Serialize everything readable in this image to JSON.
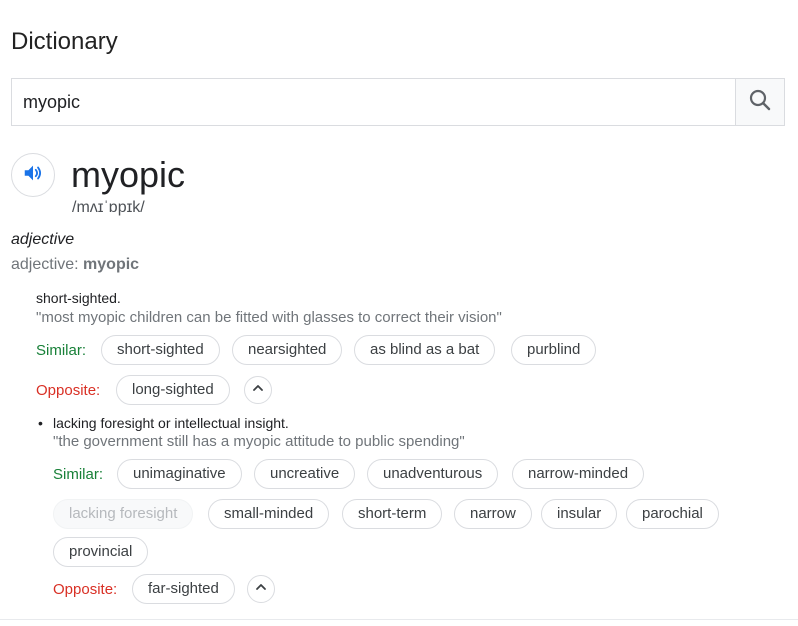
{
  "panel": {
    "title": "Dictionary"
  },
  "search": {
    "value": "myopic"
  },
  "entry": {
    "word": "myopic",
    "phonetic": "/mʌɪˈɒpɪk/",
    "part_of_speech": "adjective",
    "pos_prefix": "adjective: ",
    "pos_word": "myopic"
  },
  "senses": [
    {
      "definition": "short-sighted.",
      "example": "\"most myopic children can be fitted with glasses to correct their vision\"",
      "similar_label": "Similar:",
      "similar": [
        "short-sighted",
        "nearsighted",
        "as blind as a bat",
        "purblind"
      ],
      "opposite_label": "Opposite:",
      "opposite": [
        "long-sighted"
      ]
    },
    {
      "bullet": "•",
      "definition": "lacking foresight or intellectual insight.",
      "example": "\"the government still has a myopic attitude to public spending\"",
      "similar_label": "Similar:",
      "similar": [
        "unimaginative",
        "uncreative",
        "unadventurous",
        "narrow-minded",
        "lacking foresight",
        "small-minded",
        "short-term",
        "narrow",
        "insular",
        "parochial",
        "provincial"
      ],
      "opposite_label": "Opposite:",
      "opposite": [
        "far-sighted"
      ]
    }
  ],
  "icons": {
    "search": "search-icon",
    "speaker": "speaker-icon",
    "collapse": "chevron-up-icon"
  },
  "colors": {
    "similar_label": "#188038",
    "opposite_label": "#d93025",
    "speaker_blue": "#1a73e8"
  }
}
